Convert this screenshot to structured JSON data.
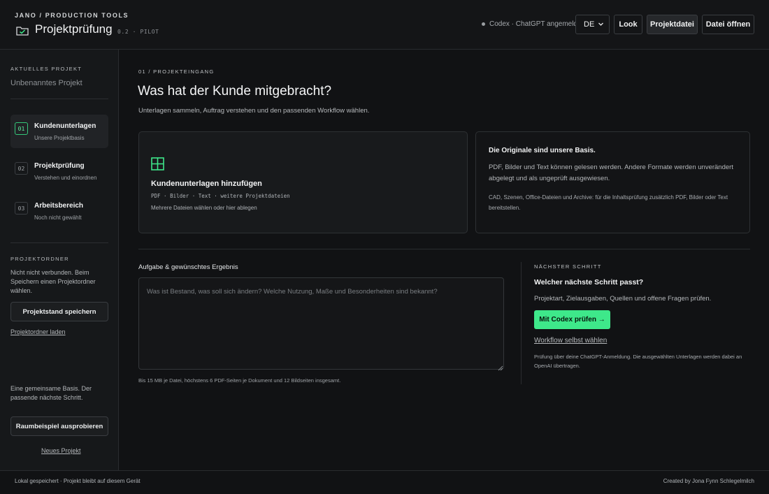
{
  "header": {
    "kicker": "JANO / PRODUCTION TOOLS",
    "title": "Projektprüfung",
    "version": "0.2 · PILOT",
    "status": "Codex · ChatGPT angemeldet",
    "language": "DE",
    "look_label": "Look",
    "project_file_label": "Projektdatei",
    "open_file_label": "Datei öffnen"
  },
  "sidebar": {
    "current_label": "AKTUELLES PROJEKT",
    "project_name": "Unbenanntes Projekt",
    "steps": [
      {
        "num": "01",
        "title": "Kundenunterlagen",
        "sub": "Unsere Projektbasis",
        "active": true
      },
      {
        "num": "02",
        "title": "Projektprüfung",
        "sub": "Verstehen und einordnen",
        "active": false
      },
      {
        "num": "03",
        "title": "Arbeitsbereich",
        "sub": "Noch nicht gewählt",
        "active": false
      }
    ],
    "folder_label": "PROJEKTORDNER",
    "folder_text": "Nicht nicht verbunden. Beim Speichern einen Projektordner wählen.",
    "save_label": "Projektstand speichern",
    "load_link": "Projektordner laden",
    "tagline": "Eine gemeinsame Basis. Der passende nächste Schritt.",
    "example_label": "Raumbeispiel ausprobieren",
    "new_link": "Neues Projekt"
  },
  "main": {
    "kicker": "01 / PROJEKTEINGANG",
    "title": "Was hat der Kunde mitgebracht?",
    "lead": "Unterlagen sammeln, Auftrag verstehen und den passenden Workflow wählen.",
    "upload": {
      "title": "Kundenunterlagen hinzufügen",
      "formats": "PDF · Bilder · Text · weitere Projektdateien",
      "hint": "Mehrere Dateien wählen oder hier ablegen"
    },
    "info": {
      "title": "Die Originale sind unsere Basis.",
      "body": "PDF, Bilder und Text können gelesen werden. Andere Formate werden unverändert abgelegt und als ungeprüft ausgewiesen.",
      "note": "CAD, Szenen, Office-Dateien und Archive: für die Inhaltsprüfung zusätzlich PDF, Bilder oder Text bereitstellen."
    },
    "task": {
      "label": "Aufgabe & gewünschtes Ergebnis",
      "placeholder": "Was ist Bestand, was soll sich ändern? Welche Nutzung, Maße und Besonderheiten sind bekannt?",
      "limit": "Bis 15 MB je Datei, höchstens 6 PDF-Seiten je Dokument und 12 Bildseiten insgesamt."
    },
    "next": {
      "kicker": "NÄCHSTER SCHRITT",
      "title": "Welcher nächste Schritt passt?",
      "body": "Projektart, Zielausgaben, Quellen und offene Fragen prüfen.",
      "primary_label": "Mit Codex prüfen →",
      "link": "Workflow selbst wählen",
      "note": "Prüfung über deine ChatGPT-Anmeldung. Die ausgewählten Unterlagen werden dabei an OpenAI übertragen."
    }
  },
  "footer": {
    "left": "Lokal gespeichert · Projekt bleibt auf diesem Gerät",
    "right": "Created by Jona Fynn Schlegelmilch"
  },
  "colors": {
    "accent": "#3ee88a",
    "background": "#111214",
    "panel": "#181a1c"
  }
}
